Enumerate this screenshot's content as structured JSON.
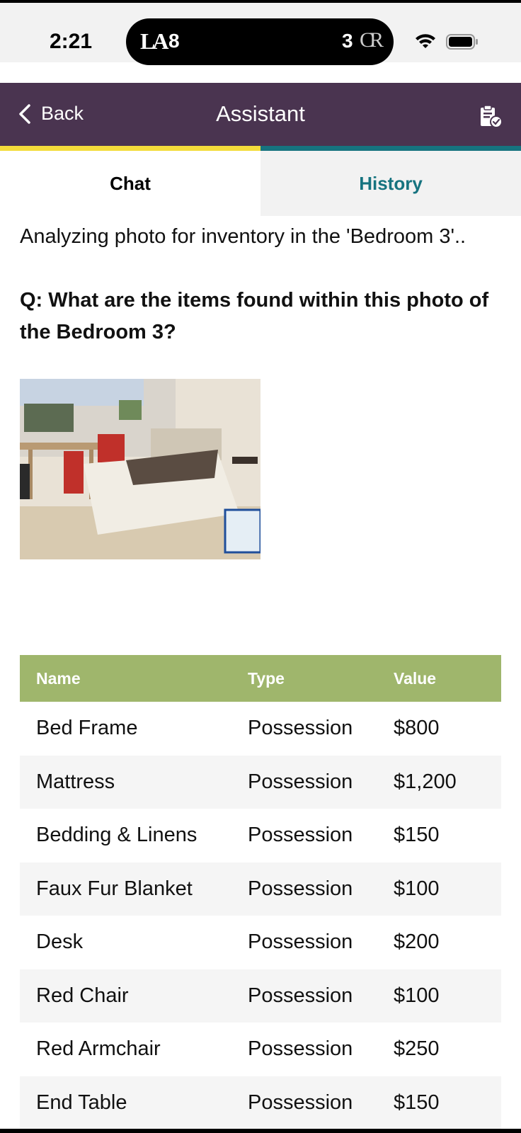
{
  "status_bar": {
    "time": "2:21",
    "live_activity": {
      "team1_logo": "LA",
      "team1_score": "8",
      "team2_score": "3",
      "team2_logo": "CR"
    }
  },
  "header": {
    "back_label": "Back",
    "title": "Assistant",
    "right_icon": "clipboard-check-icon",
    "bg_color": "#4a3450"
  },
  "tabs": {
    "chat": "Chat",
    "history": "History"
  },
  "chat": {
    "status_message": "Analyzing photo for inventory in the 'Bedroom 3'..",
    "question": "Q: What are the items found within this photo of the Bedroom 3?"
  },
  "table": {
    "headers": {
      "name": "Name",
      "type": "Type",
      "value": "Value"
    },
    "rows": [
      {
        "name": "Bed Frame",
        "type": "Possession",
        "value": "$800"
      },
      {
        "name": "Mattress",
        "type": "Possession",
        "value": "$1,200"
      },
      {
        "name": "Bedding & Linens",
        "type": "Possession",
        "value": "$150"
      },
      {
        "name": "Faux Fur Blanket",
        "type": "Possession",
        "value": "$100"
      },
      {
        "name": "Desk",
        "type": "Possession",
        "value": "$200"
      },
      {
        "name": "Red Chair",
        "type": "Possession",
        "value": "$100"
      },
      {
        "name": "Red Armchair",
        "type": "Possession",
        "value": "$250"
      },
      {
        "name": "End Table",
        "type": "Possession",
        "value": "$150"
      }
    ]
  },
  "colors": {
    "accent_yellow": "#f3dc3b",
    "accent_teal": "#16737f",
    "table_header": "#9fb66c"
  }
}
